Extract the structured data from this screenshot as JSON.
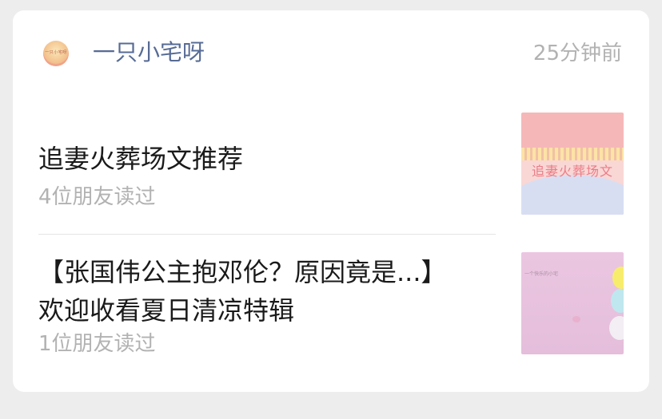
{
  "header": {
    "account_name": "一只小宅呀",
    "avatar_text": "一只小宅呀",
    "timestamp": "25分钟前"
  },
  "articles": [
    {
      "title": "追妻火葬场文推荐",
      "reads": "4位朋友读过",
      "thumbnail_text": "追妻火葬场文"
    },
    {
      "title_line1": "【张国伟公主抱邓伦？原因竟是...】",
      "title_line2": "欢迎收看夏日清凉特辑",
      "reads": "1位朋友读过",
      "thumbnail_text": "一个快乐的小宅"
    }
  ],
  "colors": {
    "background": "#ededed",
    "card": "#ffffff",
    "account_name": "#576b95",
    "title": "#1a1a1a",
    "secondary_text": "#b2b2b2",
    "divider": "#e5e5e5"
  }
}
